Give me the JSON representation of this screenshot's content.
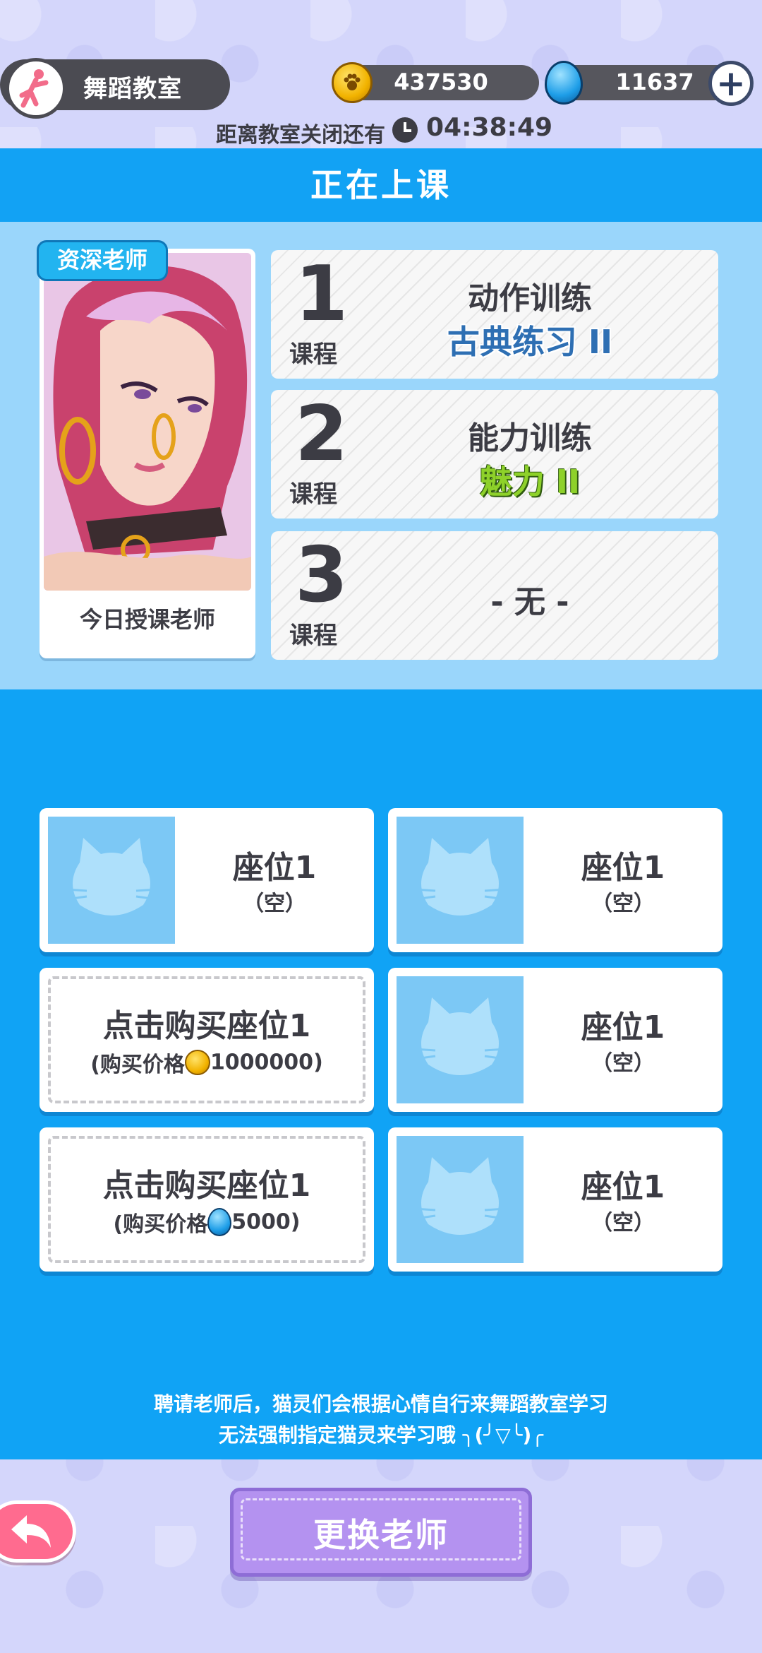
{
  "header": {
    "room_title": "舞蹈教室",
    "coins": "437530",
    "gems": "11637",
    "close_label": "距离教室关闭还有",
    "close_time": "04:38:49"
  },
  "class_banner": "正在上课",
  "teacher": {
    "badge": "资深老师",
    "caption": "今日授课老师"
  },
  "courses": [
    {
      "number": "1",
      "tag": "课程",
      "title": "动作训练",
      "subtitle": "古典练习 II",
      "subtitle_color": "#2e6fb3"
    },
    {
      "number": "2",
      "tag": "课程",
      "title": "能力训练",
      "subtitle": "魅力 II",
      "subtitle_color": "#8ed12a"
    },
    {
      "number": "3",
      "tag": "课程",
      "empty": "- 无 -"
    }
  ],
  "seats": [
    {
      "title": "座位1",
      "status": "（空）"
    },
    {
      "title": "座位1",
      "status": "（空）"
    },
    {
      "buy_title": "点击购买座位1",
      "price_label": "(购买价格",
      "price": "1000000",
      "price_close": ")",
      "currency": "coin"
    },
    {
      "title": "座位1",
      "status": "（空）"
    },
    {
      "buy_title": "点击购买座位1",
      "price_label": "(购买价格",
      "price": "5000",
      "price_close": ")",
      "currency": "gem"
    },
    {
      "title": "座位1",
      "status": "（空）"
    }
  ],
  "notes": {
    "line1": "聘请老师后，猫灵们会根据心情自行来舞蹈教室学习",
    "line2": "无法强制指定猫灵来学习哦 ╮(╯▽╰)╭"
  },
  "buttons": {
    "change_teacher": "更换老师"
  },
  "colors": {
    "primary_blue": "#10a3f5",
    "light_blue_panel": "#9ad6fb",
    "button_purple": "#b492f0",
    "back_pink": "#ff6b8f"
  }
}
